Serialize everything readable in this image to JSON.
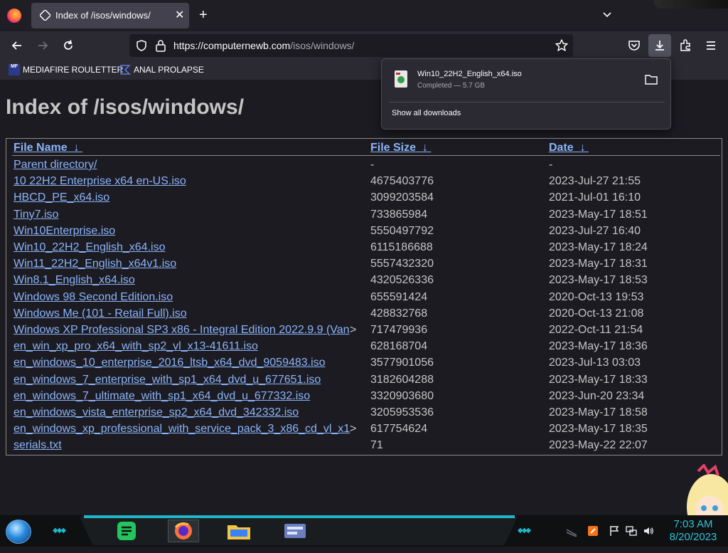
{
  "browser": {
    "tab": {
      "title": "Index of /isos/windows/"
    },
    "url": {
      "host": "https://computernewb.com",
      "path": "/isos/windows/"
    },
    "bookmarks": [
      {
        "label": "MEDIAFIRE ROULETTER",
        "icon_text": "MF",
        "icon": "mediafire-icon"
      },
      {
        "label": "ANAL PROLAPSE",
        "icon": "bookmark-icon"
      }
    ]
  },
  "downloads": {
    "file": "Win10_22H2_English_x64.iso",
    "status": "Completed — 5.7 GB",
    "show_all": "Show all downloads"
  },
  "page": {
    "title": "Index of /isos/windows/",
    "headers": {
      "name": "File Name",
      "size": "File Size",
      "date": "Date",
      "sort_arrow": "↓"
    },
    "rows": [
      {
        "name": "Parent directory/",
        "size": "-",
        "date": "-"
      },
      {
        "name": "10 22H2 Enterprise x64 en-US.iso",
        "size": "4675403776",
        "date": "2023-Jul-27 21:55"
      },
      {
        "name": "HBCD_PE_x64.iso",
        "size": "3099203584",
        "date": "2021-Jul-01 16:10"
      },
      {
        "name": "Tiny7.iso",
        "size": "733865984",
        "date": "2023-May-17 18:51"
      },
      {
        "name": "Win10Enterprise.iso",
        "size": "5550497792",
        "date": "2023-Jul-27 16:40"
      },
      {
        "name": "Win10_22H2_English_x64.iso",
        "size": "6115186688",
        "date": "2023-May-17 18:24"
      },
      {
        "name": "Win11_22H2_English_x64v1.iso",
        "size": "5557432320",
        "date": "2023-May-17 18:31"
      },
      {
        "name": "Win8.1_English_x64.iso",
        "size": "4320526336",
        "date": "2023-May-17 18:53"
      },
      {
        "name": "Windows 98 Second Edition.iso",
        "size": "655591424",
        "date": "2020-Oct-13 19:53"
      },
      {
        "name": "Windows Me (101 - Retail Full).iso",
        "size": "428832768",
        "date": "2020-Oct-13 21:08"
      },
      {
        "name": "Windows XP Professional SP3 x86 - Integral Edition 2022.9.9 (Van",
        "trunc": ">",
        "size": "717479936",
        "date": "2022-Oct-11 21:54"
      },
      {
        "name": "en_win_xp_pro_x64_with_sp2_vl_x13-41611.iso",
        "size": "628168704",
        "date": "2023-May-17 18:36"
      },
      {
        "name": "en_windows_10_enterprise_2016_ltsb_x64_dvd_9059483.iso",
        "size": "3577901056",
        "date": "2023-Jul-13 03:03"
      },
      {
        "name": "en_windows_7_enterprise_with_sp1_x64_dvd_u_677651.iso",
        "size": "3182604288",
        "date": "2023-May-17 18:33"
      },
      {
        "name": "en_windows_7_ultimate_with_sp1_x64_dvd_u_677332.iso",
        "size": "3320903680",
        "date": "2023-Jun-20 23:34"
      },
      {
        "name": "en_windows_vista_enterprise_sp2_x64_dvd_342332.iso",
        "size": "3205953536",
        "date": "2023-May-17 18:58"
      },
      {
        "name": "en_windows_xp_professional_with_service_pack_3_x86_cd_vl_x1",
        "trunc": ">",
        "size": "617754624",
        "date": "2023-May-17 18:35"
      },
      {
        "name": "serials.txt",
        "size": "71",
        "date": "2023-May-22 22:07"
      }
    ]
  },
  "taskbar": {
    "time": "7:03 AM",
    "date": "8/20/2023"
  },
  "colors": {
    "link": "#8ab4f8",
    "accent": "#1fb6c9",
    "text": "#c5c5c5"
  }
}
